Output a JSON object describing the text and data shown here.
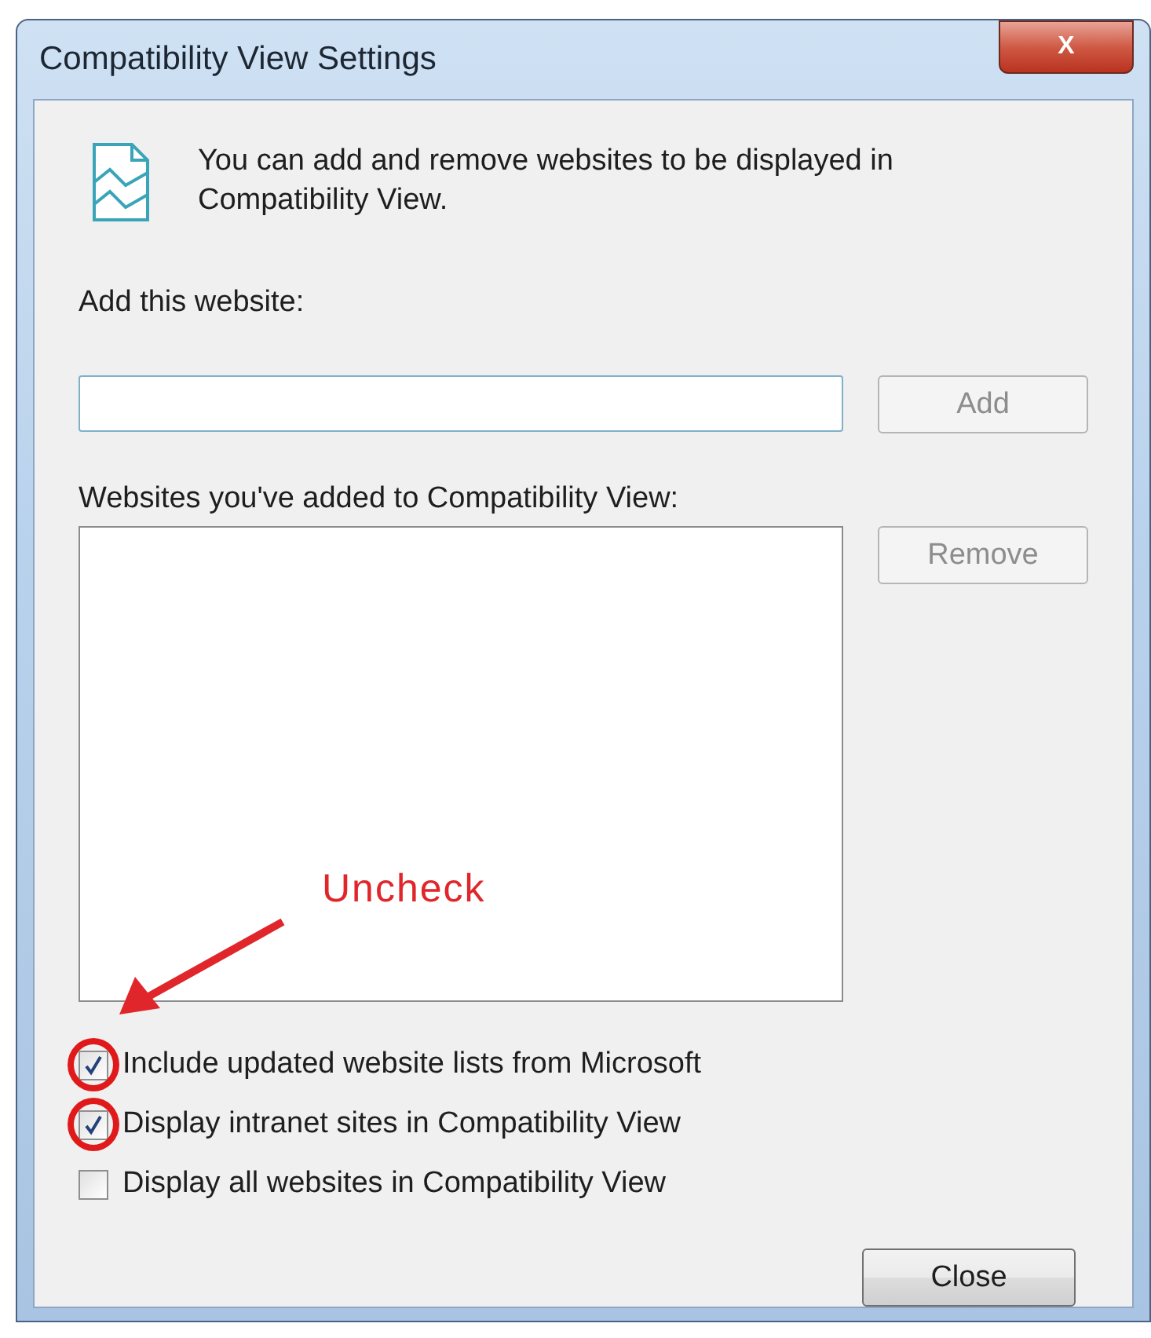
{
  "window": {
    "title": "Compatibility View Settings",
    "close_label": "X"
  },
  "intro": "You can add and remove websites to be displayed in Compatibility View.",
  "add_field": {
    "label": "Add this website:"
  },
  "add_button": {
    "label": "Add",
    "disabled": true
  },
  "list": {
    "label": "Websites you've added to Compatibility View:"
  },
  "remove_button": {
    "label": "Remove",
    "disabled": true
  },
  "options": [
    {
      "label": "Include updated website lists from Microsoft",
      "checked": true,
      "circled": true
    },
    {
      "label": "Display intranet sites in Compatibility View",
      "checked": true,
      "circled": true
    },
    {
      "label": "Display all websites in Compatibility View",
      "checked": false,
      "circled": false
    }
  ],
  "close_button": {
    "label": "Close"
  },
  "annotation": {
    "text": "Uncheck"
  }
}
